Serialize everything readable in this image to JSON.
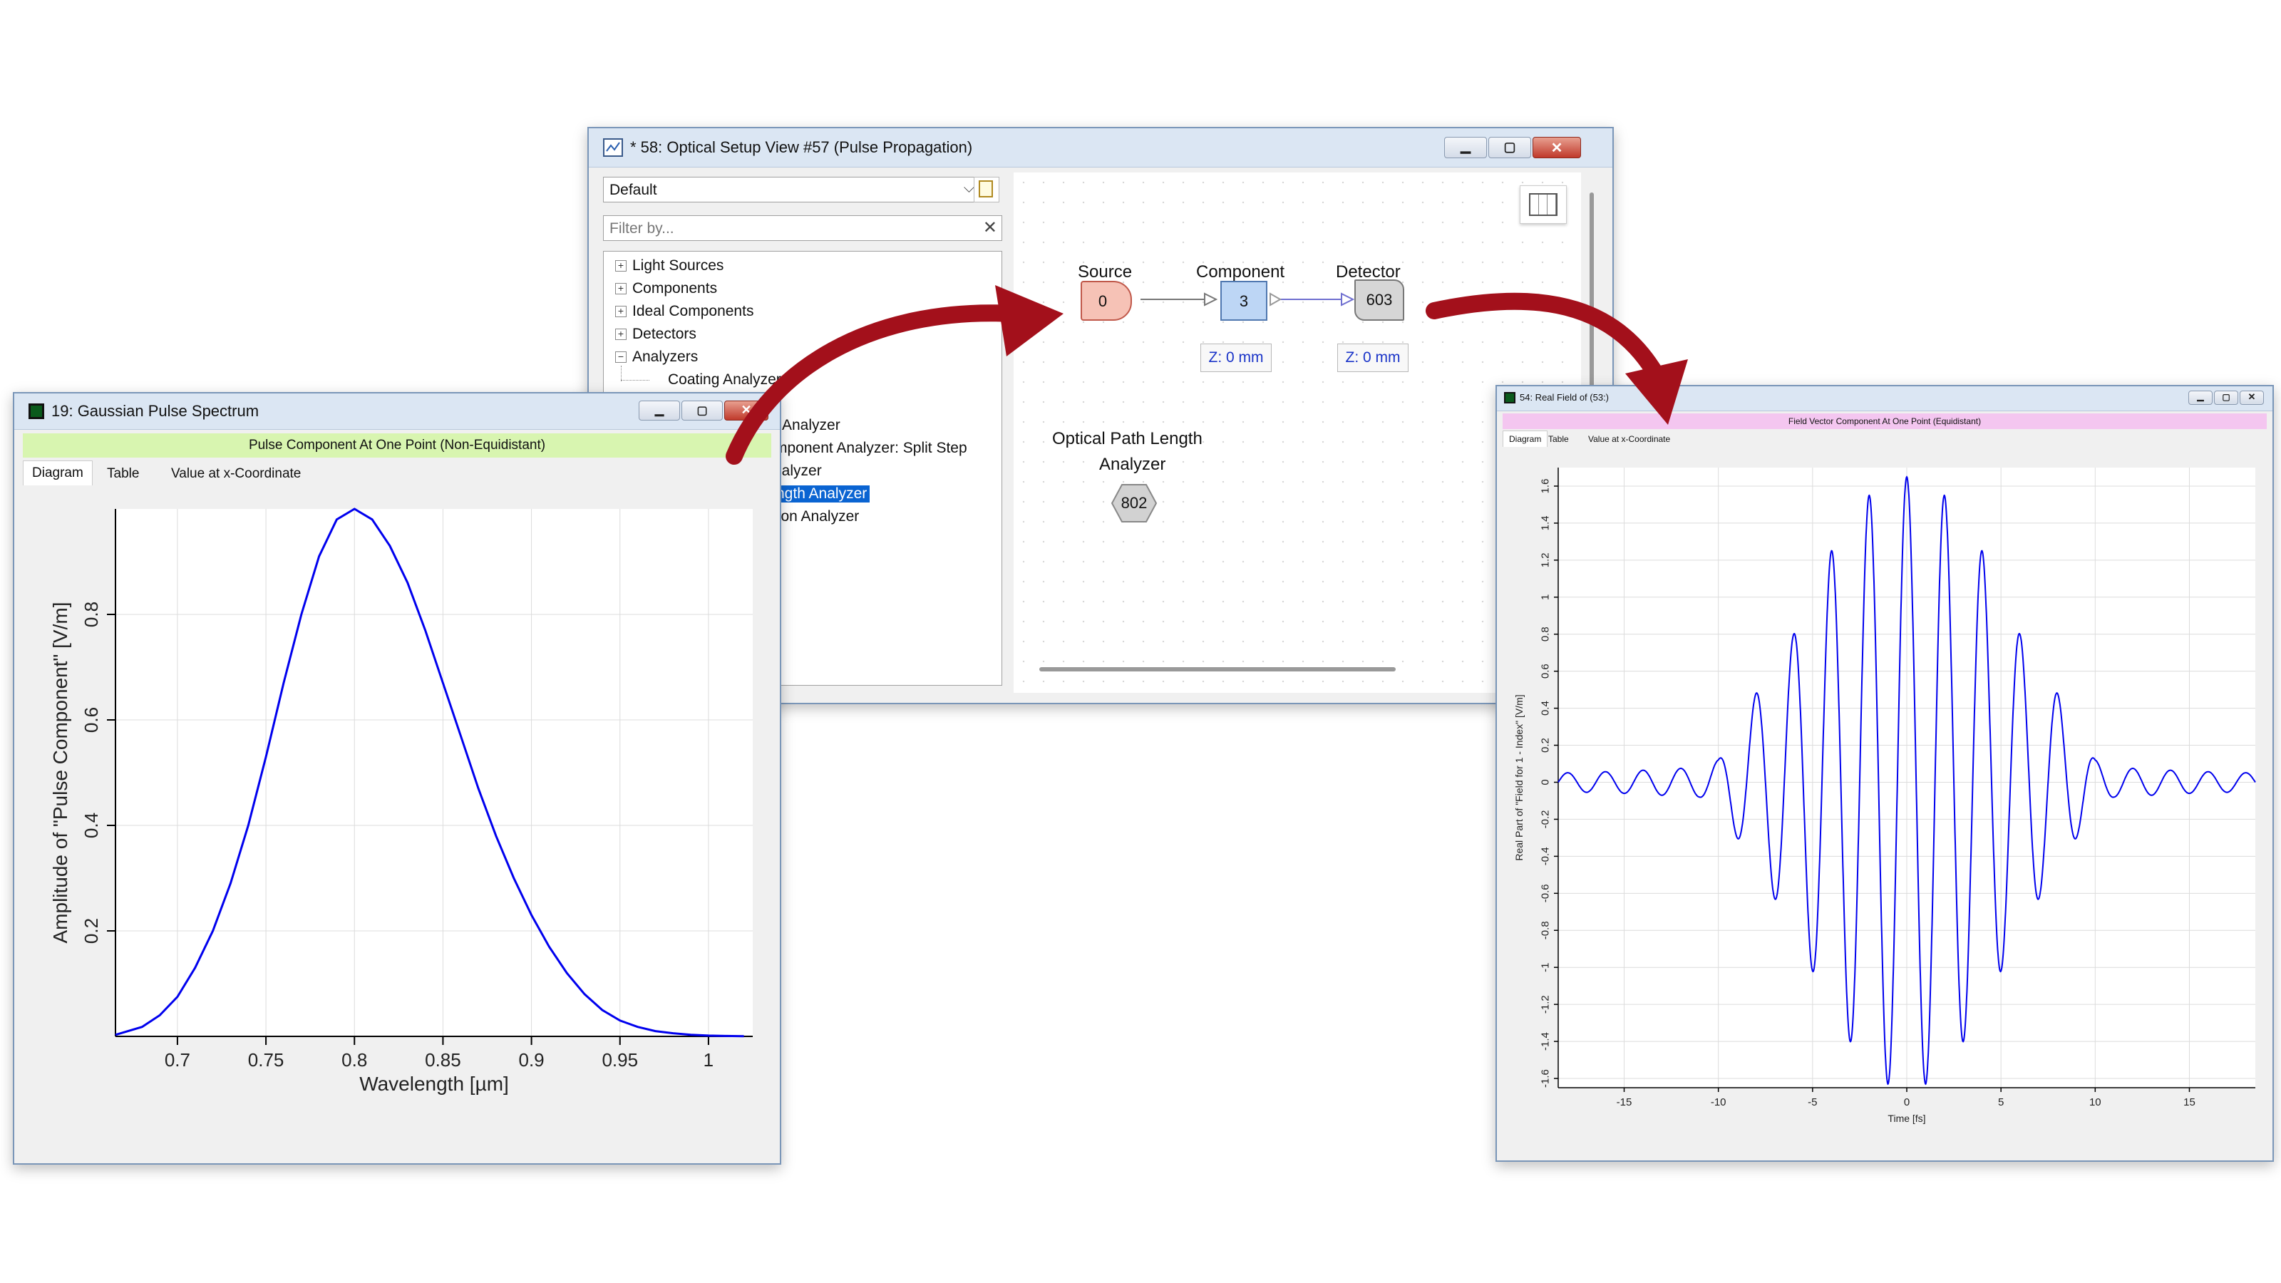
{
  "colors": {
    "accent_red": "#a3101b",
    "curve_blue": "#0000ee",
    "selection_blue": "#0a64d2",
    "banner_green": "#d8f5b0",
    "banner_pink": "#f4c6f0"
  },
  "setup_window": {
    "title": "* 58: Optical Setup View #57 (Pulse Propagation)",
    "icon": "setup-view-icon",
    "catalog_select": "Default",
    "filter_placeholder": "Filter by...",
    "tree": [
      {
        "label": "Light Sources",
        "expander": "+"
      },
      {
        "label": "Components",
        "expander": "+"
      },
      {
        "label": "Ideal Components",
        "expander": "+"
      },
      {
        "label": "Detectors",
        "expander": "+"
      },
      {
        "label": "Analyzers",
        "expander": "−"
      },
      {
        "label": "Coating Analyzer",
        "expander": ""
      },
      {
        "label": "Analyzer",
        "expander": ""
      },
      {
        "label": "mponent Analyzer: Split Step",
        "expander": ""
      },
      {
        "label": "nalyzer",
        "expander": ""
      },
      {
        "label": "ngth Analyzer",
        "expander": "",
        "selected": true
      },
      {
        "label": "tion Analyzer",
        "expander": ""
      }
    ],
    "nodes": {
      "source": {
        "label": "Source",
        "value": "0",
        "z": ""
      },
      "component": {
        "label": "Component",
        "value": "3",
        "z": "Z: 0 mm"
      },
      "detector": {
        "label": "Detector",
        "value": "603",
        "z": "Z: 0 mm"
      },
      "analyzer": {
        "label_line1": "Optical Path Length",
        "label_line2": "Analyzer",
        "value": "802"
      }
    }
  },
  "spectrum_window": {
    "title": "19: Gaussian Pulse Spectrum",
    "banner": "Pulse Component At One Point (Non-Equidistant)",
    "tabs": [
      "Diagram",
      "Table",
      "Value at x-Coordinate"
    ]
  },
  "field_window": {
    "title": "54: Real Field of (53:)",
    "banner": "Field Vector Component At One Point (Equidistant)",
    "tabs": [
      "Diagram",
      "Table",
      "Value at x-Coordinate"
    ]
  },
  "chart_data": [
    {
      "type": "line",
      "xlabel": "Wavelength [µm]",
      "ylabel": "Amplitude of \"Pulse Component\" [V/m]",
      "xlim": [
        0.665,
        1.025
      ],
      "ylim": [
        0,
        1.0
      ],
      "xticks": [
        0.7,
        0.75,
        0.8,
        0.85,
        0.9,
        0.95,
        1
      ],
      "xtick_labels": [
        "0.7",
        "0.75",
        "0.8",
        "0.85",
        "0.9",
        "0.95",
        "1"
      ],
      "yticks": [
        0.2,
        0.4,
        0.6,
        0.8
      ],
      "ytick_labels": [
        "0.2",
        "0.4",
        "0.6",
        "0.8"
      ],
      "grid": true,
      "series": [
        {
          "color": "#0000ee",
          "x": [
            0.665,
            0.68,
            0.69,
            0.7,
            0.71,
            0.72,
            0.73,
            0.74,
            0.75,
            0.76,
            0.77,
            0.78,
            0.79,
            0.8,
            0.81,
            0.82,
            0.83,
            0.84,
            0.85,
            0.86,
            0.87,
            0.88,
            0.89,
            0.9,
            0.91,
            0.92,
            0.93,
            0.94,
            0.95,
            0.96,
            0.97,
            0.98,
            0.99,
            1.0,
            1.01,
            1.02
          ],
          "y": [
            0.003,
            0.018,
            0.04,
            0.075,
            0.13,
            0.2,
            0.29,
            0.4,
            0.53,
            0.67,
            0.8,
            0.91,
            0.98,
            1.0,
            0.98,
            0.93,
            0.86,
            0.77,
            0.67,
            0.57,
            0.47,
            0.38,
            0.3,
            0.23,
            0.17,
            0.12,
            0.08,
            0.05,
            0.03,
            0.018,
            0.01,
            0.006,
            0.003,
            0.0015,
            0.0008,
            0.0004
          ]
        }
      ]
    },
    {
      "type": "line",
      "xlabel": "Time [fs]",
      "ylabel": "Real Part of \"Field for 1 - Index\" [V/m]",
      "xlim": [
        -18.5,
        18.5
      ],
      "ylim": [
        -1.65,
        1.7
      ],
      "xticks": [
        -15,
        -10,
        -5,
        0,
        5,
        10,
        15
      ],
      "xtick_labels": [
        "-15",
        "-10",
        "-5",
        "0",
        "5",
        "10",
        "15"
      ],
      "yticks": [
        -1.6,
        -1.4,
        -1.2,
        -1,
        -0.8,
        -0.6,
        -0.4,
        -0.2,
        0,
        0.2,
        0.4,
        0.6,
        0.8,
        1,
        1.2,
        1.4,
        1.6
      ],
      "ytick_labels": [
        "-1.6",
        "-1.4",
        "-1.2",
        "-1",
        "-0.8",
        "-0.6",
        "-0.4",
        "-0.2",
        "0",
        "0.2",
        "0.4",
        "0.6",
        "0.8",
        "1",
        "1.2",
        "1.4",
        "1.6"
      ],
      "grid": true,
      "series": [
        {
          "color": "#0000ee",
          "model": "A(t)·cos(2π t / T)",
          "period_fs": 2.0,
          "envelope_t": [
            -18.5,
            -15,
            -13,
            -11,
            -10,
            -9,
            -8,
            -7,
            -6,
            -5,
            -4,
            -3,
            -2,
            -1,
            0,
            1,
            2,
            3,
            4,
            5,
            6,
            7,
            8,
            9,
            10,
            11,
            13,
            15,
            18.5
          ],
          "envelope_a": [
            0.05,
            0.06,
            0.07,
            0.08,
            0.12,
            0.3,
            0.48,
            0.63,
            0.8,
            1.02,
            1.25,
            1.4,
            1.55,
            1.63,
            1.65,
            1.63,
            1.55,
            1.4,
            1.25,
            1.02,
            0.8,
            0.63,
            0.48,
            0.3,
            0.12,
            0.08,
            0.07,
            0.06,
            0.05
          ]
        }
      ]
    }
  ]
}
